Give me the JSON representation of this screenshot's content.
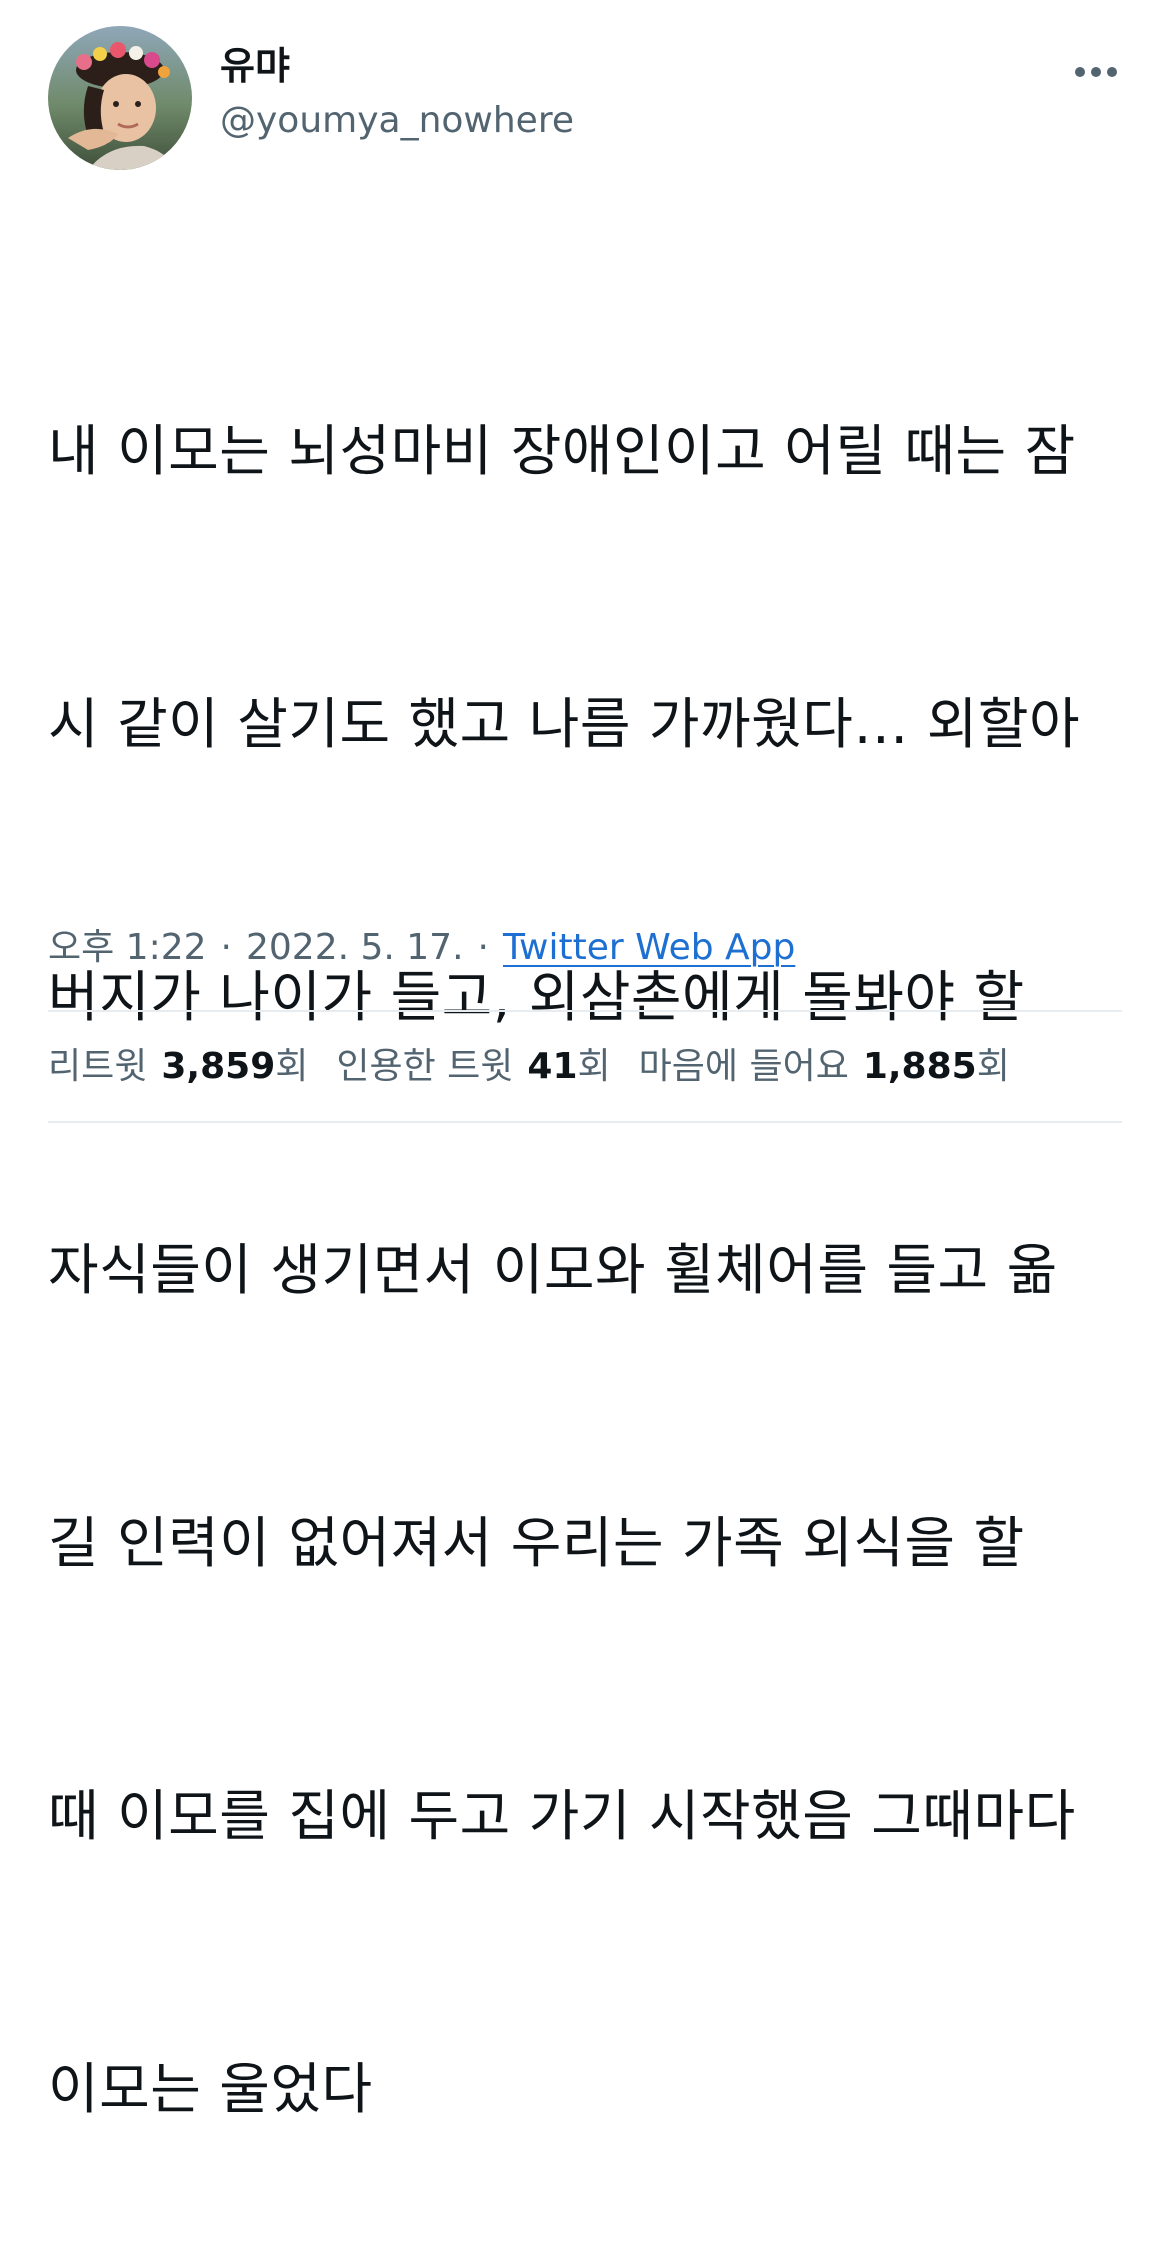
{
  "user": {
    "display_name": "유먀",
    "handle": "@youmya_nowhere"
  },
  "tweet": {
    "lines": [
      "내 이모는 뇌성마비 장애인이고 어릴 때는 잠",
      "시 같이 살기도 했고 나름 가까웠다… 외할아",
      "버지가 나이가 들고, 외삼촌에게 돌봐야 할",
      "자식들이 생기면서 이모와 휠체어를 들고 옮",
      "길 인력이 없어져서 우리는 가족 외식을 할",
      "때 이모를 집에 두고 가기 시작했음 그때마다",
      "이모는 울었다"
    ]
  },
  "meta": {
    "time": "오후 1:22",
    "separator": "·",
    "date": "2022. 5. 17.",
    "source": "Twitter Web App"
  },
  "stats": {
    "retweets": {
      "label": "리트윗",
      "count": "3,859",
      "unit": "회"
    },
    "quotes": {
      "label": "인용한 트윗",
      "count": "41",
      "unit": "회"
    },
    "likes": {
      "label": "마음에 들어요",
      "count": "1,885",
      "unit": "회"
    }
  },
  "colors": {
    "text": "#0f1419",
    "secondary": "#536471",
    "link": "#1d6fd1",
    "divider": "#e6ecf0"
  },
  "icons": {
    "more": "more-horizontal-icon",
    "avatar": "profile-avatar"
  }
}
